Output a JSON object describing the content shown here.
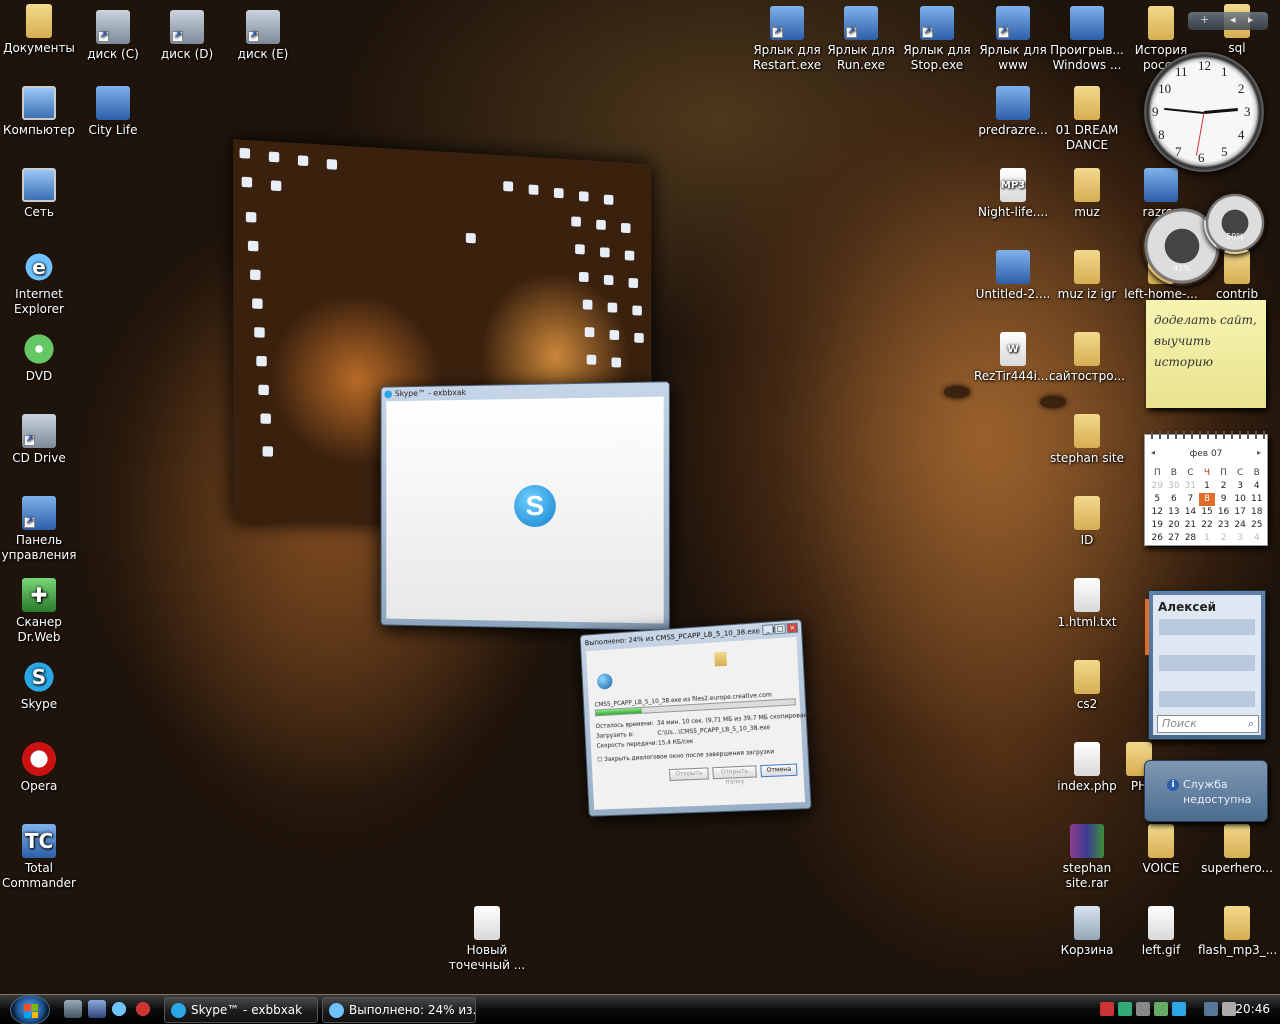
{
  "desktop_icons_left": [
    {
      "label": "Документы",
      "icon": "documents-folder-icon"
    },
    {
      "label": "диск (C)",
      "icon": "drive-c-shortcut-icon"
    },
    {
      "label": "диск (D)",
      "icon": "drive-d-shortcut-icon"
    },
    {
      "label": "диск (E)",
      "icon": "drive-e-shortcut-icon"
    },
    {
      "label": "Компьютер",
      "icon": "computer-icon"
    },
    {
      "label": "City Life",
      "icon": "city-life-game-icon"
    },
    {
      "label": "Сеть",
      "icon": "network-icon"
    },
    {
      "label": "Internet Explorer",
      "icon": "internet-explorer-icon"
    },
    {
      "label": "DVD",
      "icon": "dvd-icon"
    },
    {
      "label": "CD Drive",
      "icon": "cd-drive-icon"
    },
    {
      "label": "Панель управления",
      "icon": "control-panel-icon"
    },
    {
      "label": "Сканер Dr.Web",
      "icon": "drweb-scanner-icon"
    },
    {
      "label": "Skype",
      "icon": "skype-icon"
    },
    {
      "label": "Opera",
      "icon": "opera-icon"
    },
    {
      "label": "Total Commander",
      "icon": "total-commander-icon"
    },
    {
      "label": "Новый точечный ...",
      "icon": "bitmap-file-icon"
    }
  ],
  "desktop_icons_right": [
    {
      "label": "Ярлык для Restart.exe",
      "icon": "shortcut-icon"
    },
    {
      "label": "Ярлык для Run.exe",
      "icon": "shortcut-icon"
    },
    {
      "label": "Ярлык для Stop.exe",
      "icon": "shortcut-icon"
    },
    {
      "label": "Ярлык для www",
      "icon": "shortcut-icon"
    },
    {
      "label": "Проигрыв... Windows ...",
      "icon": "media-player-icon"
    },
    {
      "label": "История росси",
      "icon": "folder-icon"
    },
    {
      "label": "sql",
      "icon": "folder-icon"
    },
    {
      "label": "predrazre...",
      "icon": "image-file-icon"
    },
    {
      "label": "01 DREAM DANCE",
      "icon": "folder-icon"
    },
    {
      "label": "Night-life....",
      "icon": "mp3-file-icon"
    },
    {
      "label": "muz",
      "icon": "folder-icon"
    },
    {
      "label": "razrez",
      "icon": "image-file-icon"
    },
    {
      "label": "Untitled-2....",
      "icon": "image-file-icon"
    },
    {
      "label": "muz iz igr",
      "icon": "folder-icon"
    },
    {
      "label": "left-home-...",
      "icon": "folder-icon"
    },
    {
      "label": "contrib",
      "icon": "folder-icon"
    },
    {
      "label": "RezTir444i....",
      "icon": "word-document-icon"
    },
    {
      "label": "сайтостро...",
      "icon": "folder-icon"
    },
    {
      "label": "stephan site",
      "icon": "folder-icon"
    },
    {
      "label": "ID",
      "icon": "folder-icon"
    },
    {
      "label": "1.html.txt",
      "icon": "text-file-icon"
    },
    {
      "label": "cs2",
      "icon": "folder-icon"
    },
    {
      "label": "index.php",
      "icon": "php-file-icon"
    },
    {
      "label": "PH",
      "icon": "folder-icon"
    },
    {
      "label": "stephan site.rar",
      "icon": "rar-archive-icon"
    },
    {
      "label": "VOICE",
      "icon": "folder-icon"
    },
    {
      "label": "superhero...",
      "icon": "folder-icon"
    },
    {
      "label": "Корзина",
      "icon": "recycle-bin-icon"
    },
    {
      "label": "left.gif",
      "icon": "gif-file-icon"
    },
    {
      "label": "flash_mp3_...",
      "icon": "folder-icon"
    }
  ],
  "skype_window": {
    "title": "Skype™ - exbbxak",
    "logo": "S"
  },
  "download_window": {
    "title": "Выполнено: 24% из CMS5_PCAPP_LB_5_10_38.exe из fil...",
    "source": "CMS5_PCAPP_LB_5_10_38.exe из files2.europe.creative.com",
    "progress_percent": 24,
    "remaining_label": "Осталось времени:",
    "remaining_value": "34 мин. 10 сек. (9,71 МБ из 39,7 МБ скопировано)",
    "target_label": "Загрузить в:",
    "target_value": "C:\\Us...\\CMS5_PCAPP_LB_5_10_38.exe",
    "speed_label": "Скорость передачи:",
    "speed_value": "15,4 КБ/сек",
    "close_checkbox_label": "Закрыть диалоговое окно после завершения загрузки",
    "open_button": "Открыть",
    "open_folder_button": "Открыть папку",
    "cancel_button": "Отмена"
  },
  "gadgets": {
    "clock": {
      "numbers": [
        "12",
        "1",
        "2",
        "3",
        "4",
        "5",
        "6",
        "7",
        "8",
        "9",
        "10",
        "11"
      ],
      "time": "20:46"
    },
    "cpu_meter": {
      "cpu": "41%",
      "memory": "59%"
    },
    "note": "доделать сайт, выучить историю",
    "calendar": {
      "month": "фев 07",
      "weekdays": [
        "П",
        "В",
        "С",
        "Ч",
        "П",
        "С",
        "В"
      ],
      "days": [
        {
          "d": "29",
          "dim": true
        },
        {
          "d": "30",
          "dim": true
        },
        {
          "d": "31",
          "dim": true
        },
        {
          "d": "1"
        },
        {
          "d": "2"
        },
        {
          "d": "3"
        },
        {
          "d": "4"
        },
        {
          "d": "5"
        },
        {
          "d": "6"
        },
        {
          "d": "7"
        },
        {
          "d": "8",
          "today": true
        },
        {
          "d": "9"
        },
        {
          "d": "10"
        },
        {
          "d": "11"
        },
        {
          "d": "12"
        },
        {
          "d": "13"
        },
        {
          "d": "14"
        },
        {
          "d": "15"
        },
        {
          "d": "16"
        },
        {
          "d": "17"
        },
        {
          "d": "18"
        },
        {
          "d": "19"
        },
        {
          "d": "20"
        },
        {
          "d": "21"
        },
        {
          "d": "22"
        },
        {
          "d": "23"
        },
        {
          "d": "24"
        },
        {
          "d": "25"
        },
        {
          "d": "26"
        },
        {
          "d": "27"
        },
        {
          "d": "28"
        },
        {
          "d": "1",
          "dim": true
        },
        {
          "d": "2",
          "dim": true
        },
        {
          "d": "3",
          "dim": true
        },
        {
          "d": "4",
          "dim": true
        }
      ]
    },
    "contacts": {
      "name": "Алексей",
      "search_placeholder": "Поиск"
    },
    "weather": {
      "message": "Служба недоступна"
    }
  },
  "taskbar": {
    "tasks": [
      {
        "label": "Skype™ - exbbxak",
        "icon": "skype-icon"
      },
      {
        "label": "Выполнено: 24% из...",
        "icon": "internet-explorer-icon"
      }
    ],
    "clock": "20:46"
  },
  "colors": {
    "accent": "#e06e2a",
    "taskbar": "#0c0c0c",
    "note": "#f6f4b2"
  }
}
